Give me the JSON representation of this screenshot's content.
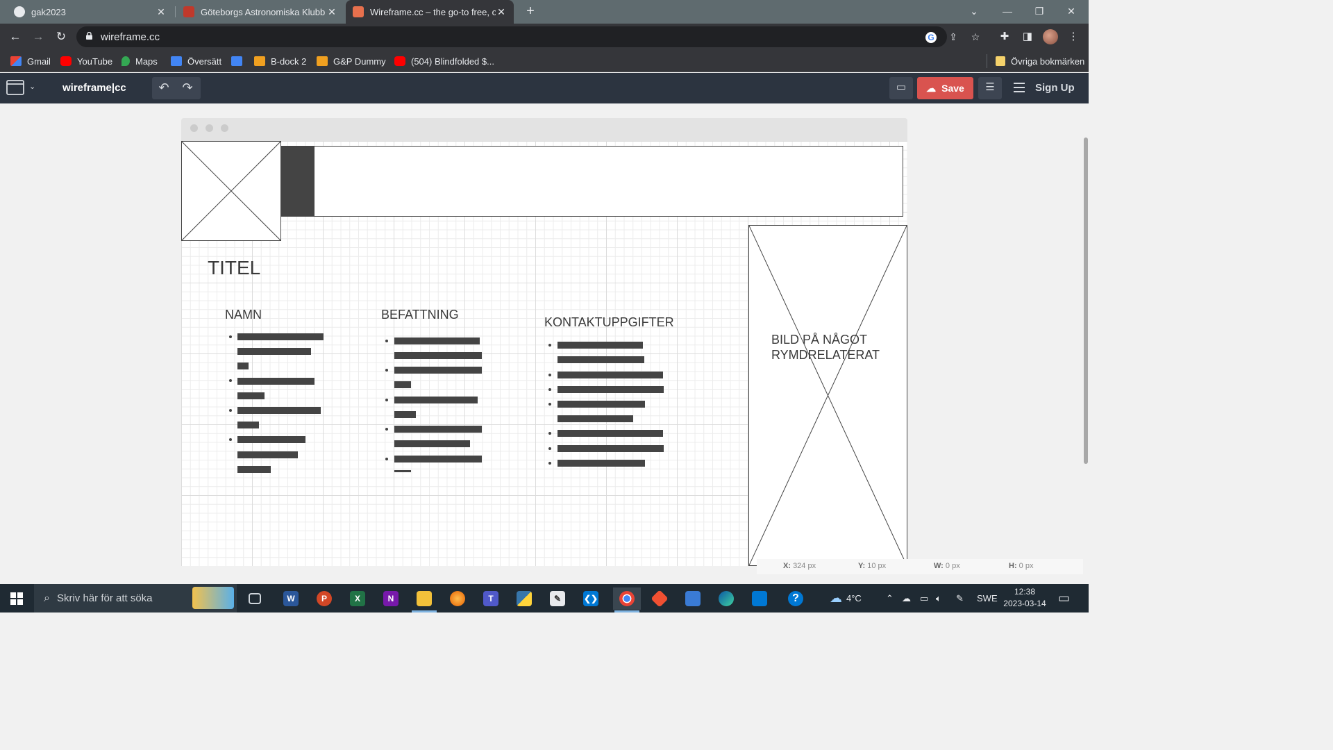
{
  "browser": {
    "tabs": [
      {
        "title": "gak2023",
        "color": "#e8eaed"
      },
      {
        "title": "Göteborgs Astronomiska Klubb",
        "color": "#c0392b"
      },
      {
        "title": "Wireframe.cc – the go-to free, on",
        "color": "#e8704d",
        "active": true
      }
    ],
    "url": "wireframe.cc",
    "bookmarks": [
      "Gmail",
      "YouTube",
      "Maps",
      "Översätt",
      "B-dock 2",
      "G&P Dummy",
      "(504) Blindfolded $..."
    ],
    "other_bookmarks": "Övriga bokmärken"
  },
  "app": {
    "logo": "wireframe|cc",
    "save_label": "Save",
    "signup_label": "Sign Up"
  },
  "wireframe": {
    "title": "TITEL",
    "col_name": "NAMN",
    "col_position": "BEFATTNING",
    "col_contact": "KONTAKTUPPGIFTER",
    "image_label": "BILD PÅ NÅGOT RYMDRELATERAT"
  },
  "status": {
    "x_label": "X:",
    "x_value": "324 px",
    "y_label": "Y:",
    "y_value": "10 px",
    "w_label": "W:",
    "w_value": "0 px",
    "h_label": "H:",
    "h_value": "0 px"
  },
  "taskbar": {
    "search_placeholder": "Skriv här för att söka",
    "weather": "4°C",
    "language": "SWE",
    "time": "12:38",
    "date": "2023-03-14"
  }
}
